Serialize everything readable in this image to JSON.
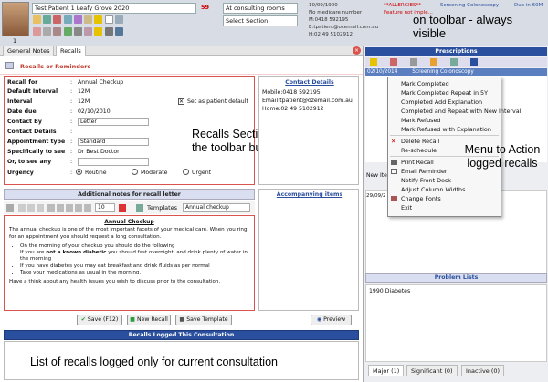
{
  "patient": {
    "name": "Test Patient 1 Leafy Grove 2020",
    "age": "59",
    "dob": "10/09/1900",
    "medicare": "No medicare number",
    "mobile": "M:0418 592195",
    "email": "E:tpatient@ozemail.com.au",
    "home": "H:02 49 5102912",
    "avatar_number": "1",
    "allergies": "**ALLERGIES**",
    "allergies_note": "Feature not imple...",
    "screening": "Screening Colonoscopy",
    "due": "Due in 60M"
  },
  "toolbar": {
    "location_value": "At consulting rooms",
    "section_value": "Select Section",
    "annotation": "on toolbar - always visible"
  },
  "tabs": {
    "general_notes": "General Notes",
    "recalls": "Recalls"
  },
  "recalls_panel": {
    "title": "Recalls or Reminders",
    "recall_for_label": "Recall for",
    "recall_for": "Annual Checkup",
    "default_interval_label": "Default Interval",
    "default_interval": "12M",
    "interval_label": "Interval",
    "interval": "12M",
    "set_default": "Set as patient default",
    "date_due_label": "Date due",
    "date_due": "02/10/2010",
    "contact_by_label": "Contact By",
    "contact_by": "Letter",
    "contact_details_label": "Contact Details",
    "appointment_type_label": "Appointment type",
    "appointment_type": "Standard",
    "specifically_label": "Specifically to see",
    "specifically": "Dr Best Doctor",
    "or_any_label": "Or, to see any",
    "urgency_label": "Urgency",
    "urgency_options": [
      "Routine",
      "Moderate",
      "Urgent"
    ]
  },
  "contact_details": {
    "title": "Contact Details",
    "mobile": "Mobile:0418 592195",
    "email": "Email:tpatient@ozemail.com.au",
    "home": "Home:02 49 5102912"
  },
  "notes": {
    "title": "Additional notes for recall letter",
    "font_size": "10",
    "templates_label": "Templates",
    "template_value": "Annual checkup",
    "heading": "Annual Checkup",
    "para1": "The annual checkup is one of the most important facets of your medical care. When you ring for an appointment you should request a long consultation.",
    "bullet1": "On the morning of your checkup you should do the following",
    "bullet2_pre": "If you are ",
    "bullet2_bold": "not a known diabetic",
    "bullet2_post": " you should fast overnight, and drink plenty of water in the morning",
    "bullet3": "If you have diabetes you may eat breakfast and drink fluids as per normal",
    "bullet4": "Take your medications as usual in the morning.",
    "para2": "Have a think about any health issues you wish to discuss prior to the consultation."
  },
  "accompanying": {
    "title": "Accompanying items"
  },
  "buttons": {
    "save": "Save (F12)",
    "new_recall": "New Recall",
    "save_template": "Save Template",
    "preview": "Preview"
  },
  "logged": {
    "title": "Recalls Logged This Consultation"
  },
  "annotations": {
    "recalls_section": "Recalls Section - Selected from the toolbar button",
    "menu": "Menu to Action logged recalls",
    "list": "List of recalls logged only for current consultation"
  },
  "prescriptions": {
    "title": "Prescriptions",
    "row_date": "02/10/2014",
    "row_text": "Screening Colonoscopy",
    "new_label": "New Ite",
    "date_fragment": "29/09/2"
  },
  "context_menu": {
    "items": [
      "Mark Completed",
      "Mark Completed Repeat in 5Y",
      "Completed Add Explanation",
      "Completed and Repeat with New Interval",
      "Mark Refused",
      "Mark Refused with Explanation",
      "Delete Recall",
      "Re-schedule",
      "Print Recall",
      "Email Reminder",
      "Notify Front Desk",
      "Adjust Column Widths",
      "Change Fonts",
      "Exit"
    ]
  },
  "problems": {
    "title": "Problem Lists",
    "item": "1990 Diabetes",
    "tab_major": "Major (1)",
    "tab_significant": "Significant (0)",
    "tab_inactive": "Inactive (0)"
  },
  "colors": {
    "header_blue": "#2a4f9e",
    "red_border": "#d9534f",
    "allergy_red": "#cc0000"
  }
}
